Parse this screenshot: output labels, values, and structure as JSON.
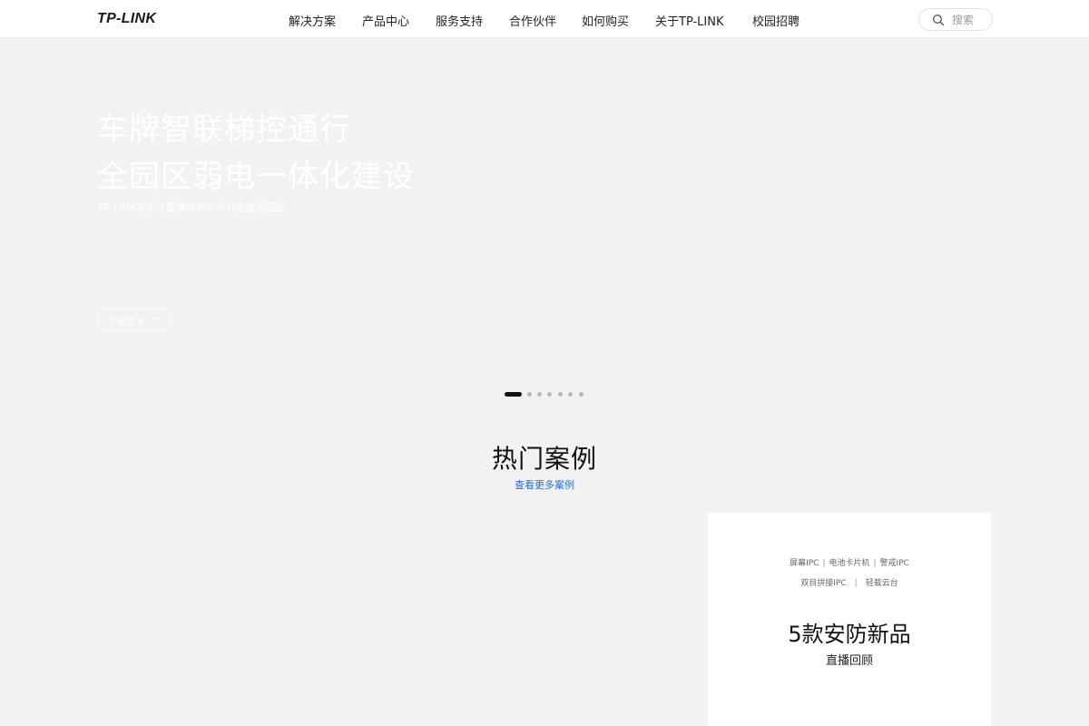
{
  "header": {
    "logo": "TP-LINK",
    "nav": [
      "解决方案",
      "产品中心",
      "服务支持",
      "合作伙伴",
      "如何购买",
      "关于TP-LINK",
      "校园招聘"
    ],
    "search": {
      "placeholder": "搜索",
      "icon": "search-icon"
    }
  },
  "hero": {
    "title_line1": "车牌智联梯控通行",
    "title_line2": "全园区弱电一体化建设",
    "subtitle": "TP-LINK为浙江晋骐纺织公司打造智慧园区",
    "button_label": "了解更多",
    "button_arrow": "→",
    "slides_total": 7,
    "active_slide": 1
  },
  "section": {
    "title": "热门案例",
    "link": "查看更多案例"
  },
  "card": {
    "tags_row1": [
      "屏幕IPC",
      "电池卡片机",
      "警戒IPC"
    ],
    "tags_row2": [
      "双目拼接IPC",
      "轻载云台"
    ],
    "title": "5款安防新品",
    "subtitle": "直播回顾"
  },
  "colors": {
    "background": "#f2f2f2",
    "header_bg": "#ffffff",
    "link_blue": "#1e6fd0",
    "hero_text": "#ffffff"
  }
}
